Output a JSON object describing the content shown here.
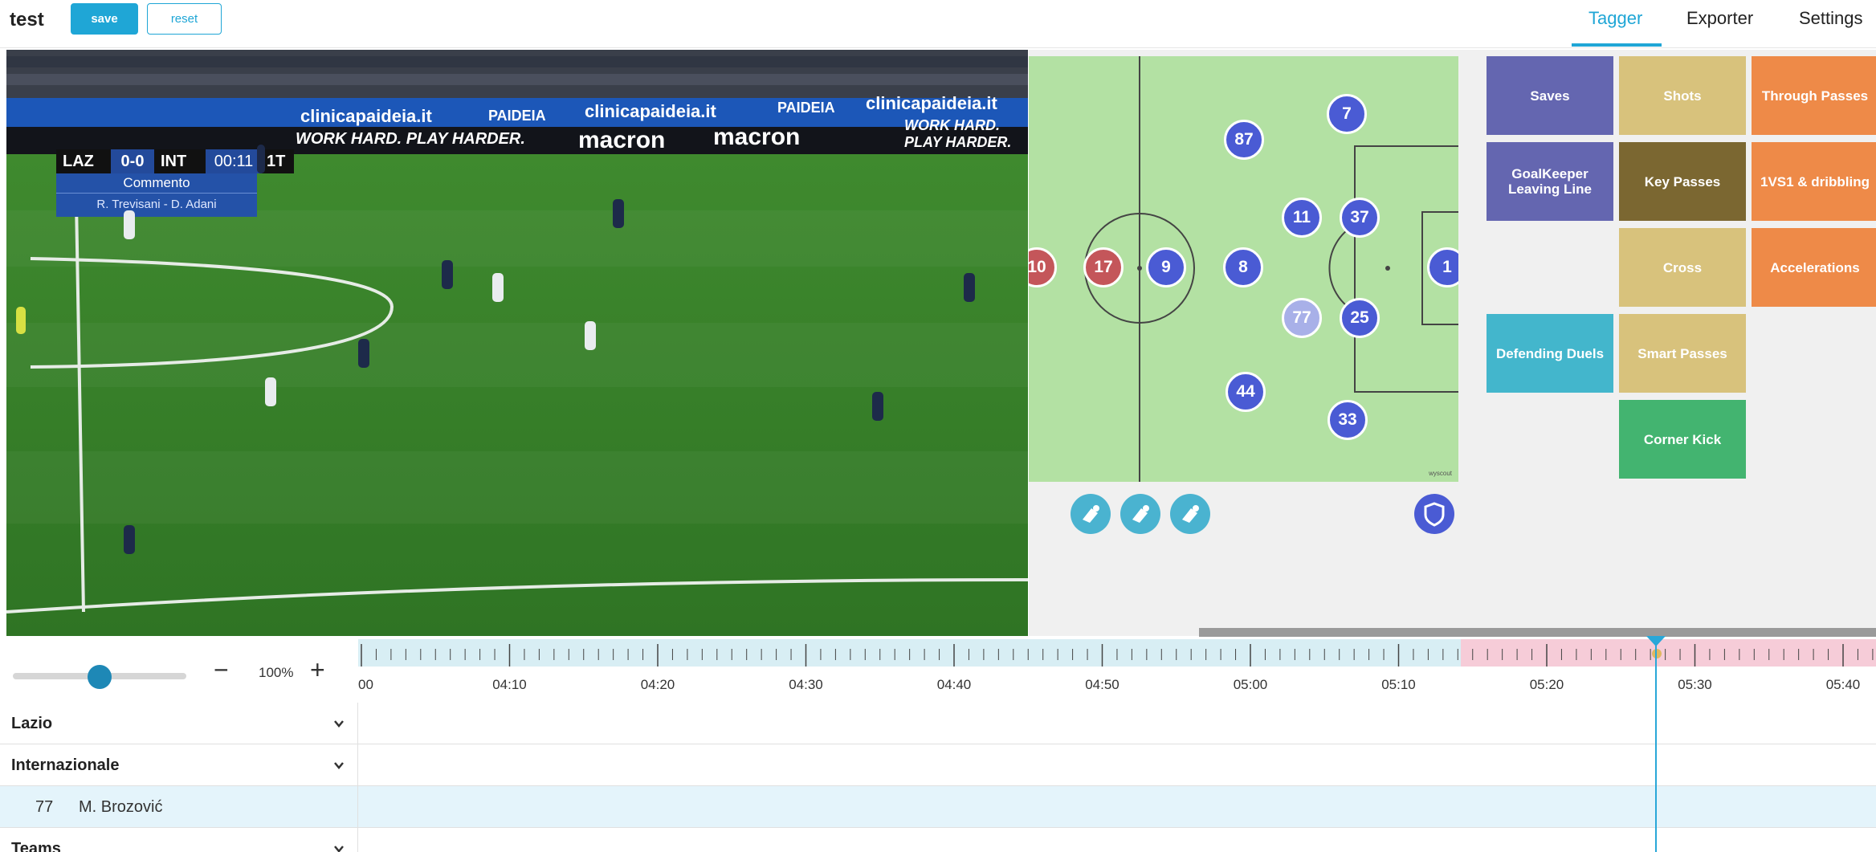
{
  "header": {
    "project_title": "test",
    "save_label": "save",
    "reset_label": "reset",
    "tabs": [
      {
        "label": "Tagger",
        "active": true
      },
      {
        "label": "Exporter",
        "active": false
      },
      {
        "label": "Settings",
        "active": false
      }
    ]
  },
  "video": {
    "scoreboard": {
      "home": "LAZ",
      "score": "0-0",
      "away": "INT",
      "time": "00:11",
      "half": "1T"
    },
    "commentary": {
      "title": "Commento",
      "names": "R. Trevisani - D. Adani"
    },
    "ads": [
      "clinicapaideia.it",
      "PAIDEIA",
      "macron",
      "WORK HARD. PLAY HARDER."
    ]
  },
  "pitch": {
    "brand": "wyscout",
    "players": [
      {
        "number": "10",
        "team": "red"
      },
      {
        "number": "17",
        "team": "red"
      },
      {
        "number": "9",
        "team": "blue"
      },
      {
        "number": "8",
        "team": "blue"
      },
      {
        "number": "87",
        "team": "blue"
      },
      {
        "number": "7",
        "team": "blue"
      },
      {
        "number": "11",
        "team": "blue"
      },
      {
        "number": "37",
        "team": "blue"
      },
      {
        "number": "1",
        "team": "blue"
      },
      {
        "number": "77",
        "team": "blue",
        "selected": true
      },
      {
        "number": "25",
        "team": "blue"
      },
      {
        "number": "44",
        "team": "blue"
      },
      {
        "number": "33",
        "team": "blue"
      }
    ]
  },
  "tags": [
    {
      "label": "Saves",
      "color": "#6466b0"
    },
    {
      "label": "Shots",
      "color": "#d8c27c"
    },
    {
      "label": "Through Passes",
      "color": "#ee8a48"
    },
    {
      "label": "GoalKeeper Leaving Line",
      "color": "#6466b0"
    },
    {
      "label": "Key Passes",
      "color": "#7b6731"
    },
    {
      "label": "1VS1 & dribbling",
      "color": "#ee8a48"
    },
    {
      "label": "Cross",
      "color": "#d8c27c"
    },
    {
      "label": "Accelerations",
      "color": "#ee8a48"
    },
    {
      "label": "Defending Duels",
      "color": "#43b6cc"
    },
    {
      "label": "Smart Passes",
      "color": "#d8c27c"
    },
    {
      "label": "Corner Kick",
      "color": "#43b470"
    }
  ],
  "timeline": {
    "zoom": "100%",
    "zoom_level": 0.5,
    "labels": [
      "00",
      "04:10",
      "04:20",
      "04:30",
      "04:40",
      "04:50",
      "05:00",
      "05:10",
      "05:20",
      "05:30",
      "05:40"
    ],
    "colors": {
      "past": "#d8eef4",
      "future": "#f6ccd8",
      "playhead": "#29a7d8"
    }
  },
  "rows": {
    "lazio": "Lazio",
    "internazionale": "Internazionale",
    "player_number": "77",
    "player_name": "M. Brozović",
    "teams": "Teams"
  },
  "colors": {
    "accent": "#1fa6d6",
    "pitch": "#b3e1a3",
    "blue_team": "#4a5bd4",
    "red_team": "#c4565a"
  }
}
